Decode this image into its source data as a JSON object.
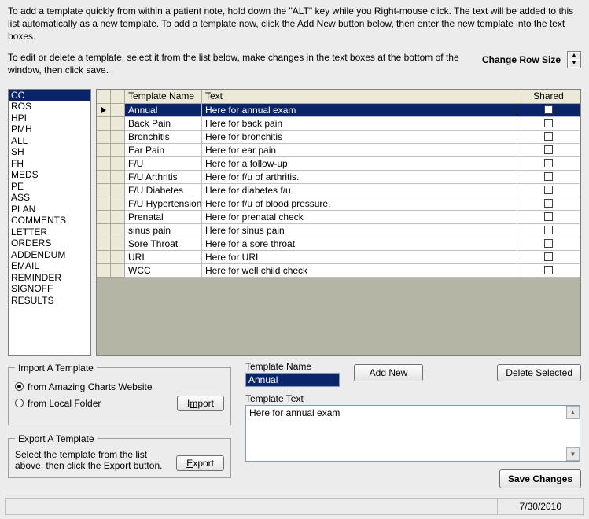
{
  "instructions": {
    "p1": "To add a template quickly from within a patient note, hold down the \"ALT\" key while you Right-mouse click. The text will be added to this list automatically as a new template. To add a template now, click the Add New button below, then enter the new template into the text boxes.",
    "p2": "To edit or delete a template, select it from the list below, make changes in the text boxes at the bottom of the window, then click save."
  },
  "row_size_label": "Change Row Size",
  "categories": [
    "CC",
    "ROS",
    "HPI",
    "PMH",
    "ALL",
    "SH",
    "FH",
    "MEDS",
    "PE",
    "ASS",
    "PLAN",
    "COMMENTS",
    "LETTER",
    "ORDERS",
    "ADDENDUM",
    "EMAIL",
    "REMINDER",
    "SIGNOFF",
    "RESULTS"
  ],
  "selected_category_index": 0,
  "grid": {
    "headers": {
      "name": "Template Name",
      "text": "Text",
      "shared": "Shared"
    },
    "rows": [
      {
        "name": "Annual",
        "text": "Here for annual exam",
        "shared": false,
        "selected": true
      },
      {
        "name": "Back Pain",
        "text": "Here for back pain",
        "shared": false
      },
      {
        "name": "Bronchitis",
        "text": "Here for bronchitis",
        "shared": false
      },
      {
        "name": "Ear Pain",
        "text": "Here for ear pain",
        "shared": false
      },
      {
        "name": "F/U",
        "text": "Here for a follow-up",
        "shared": false
      },
      {
        "name": "F/U Arthritis",
        "text": "Here for f/u of arthritis.",
        "shared": false
      },
      {
        "name": "F/U Diabetes",
        "text": "Here for diabetes f/u",
        "shared": false
      },
      {
        "name": "F/U Hypertension",
        "text": "Here for f/u of blood pressure.",
        "shared": false
      },
      {
        "name": "Prenatal",
        "text": "Here for prenatal check",
        "shared": false
      },
      {
        "name": "sinus pain",
        "text": "Here for sinus pain",
        "shared": false
      },
      {
        "name": "Sore Throat",
        "text": "Here for a sore throat",
        "shared": false
      },
      {
        "name": "URI",
        "text": "Here for URI",
        "shared": false
      },
      {
        "name": "WCC",
        "text": "Here for well child check",
        "shared": false
      }
    ]
  },
  "import": {
    "legend": "Import A Template",
    "opt1": "from Amazing Charts Website",
    "opt2": "from Local Folder",
    "selected": "opt1",
    "button": "Import"
  },
  "export": {
    "legend": "Export A Template",
    "text": "Select the template from the list above, then click the Export button.",
    "button": "Export"
  },
  "fields": {
    "name_label": "Template Name",
    "name_value": "Annual",
    "text_label": "Template Text",
    "text_value": "Here for annual exam"
  },
  "buttons": {
    "add_new": "Add New",
    "delete_selected": "Delete Selected",
    "save_changes": "Save Changes"
  },
  "status_date": "7/30/2010"
}
